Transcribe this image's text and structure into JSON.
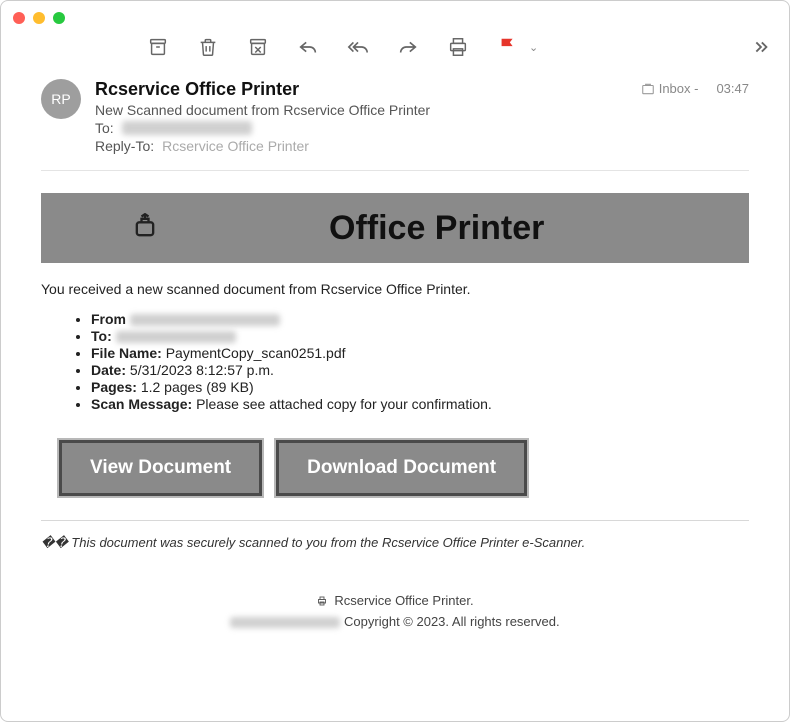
{
  "header": {
    "avatar_initials": "RP",
    "sender": "Rcservice Office Printer",
    "subject": "New Scanned document from Rcservice Office Printer",
    "to_label": "To:",
    "reply_to_label": "Reply-To:",
    "reply_to_value": "Rcservice Office Printer",
    "folder": "Inbox -",
    "time": "03:47"
  },
  "banner": {
    "title": "Office Printer"
  },
  "body": {
    "intro": "You received a new scanned document from Rcservice Office Printer.",
    "items": [
      {
        "label": "From",
        "value": ""
      },
      {
        "label": "To:",
        "value": ""
      },
      {
        "label": "File Name:",
        "value": "PaymentCopy_scan0251.pdf"
      },
      {
        "label": "Date:",
        "value": "5/31/2023 8:12:57 p.m."
      },
      {
        "label": "Pages:",
        "value": "1.2 pages (89 KB)"
      },
      {
        "label": "Scan Message:",
        "value": "Please see attached copy for your confirmation."
      }
    ],
    "view_btn": "View Document",
    "download_btn": "Download Document",
    "secure_note": "This document was securely scanned to you from the Rcservice Office Printer e-Scanner.",
    "secure_prefix": "�� "
  },
  "footer": {
    "line1": "Rcservice Office Printer.",
    "line2": "Copyright © 2023. All rights reserved."
  }
}
